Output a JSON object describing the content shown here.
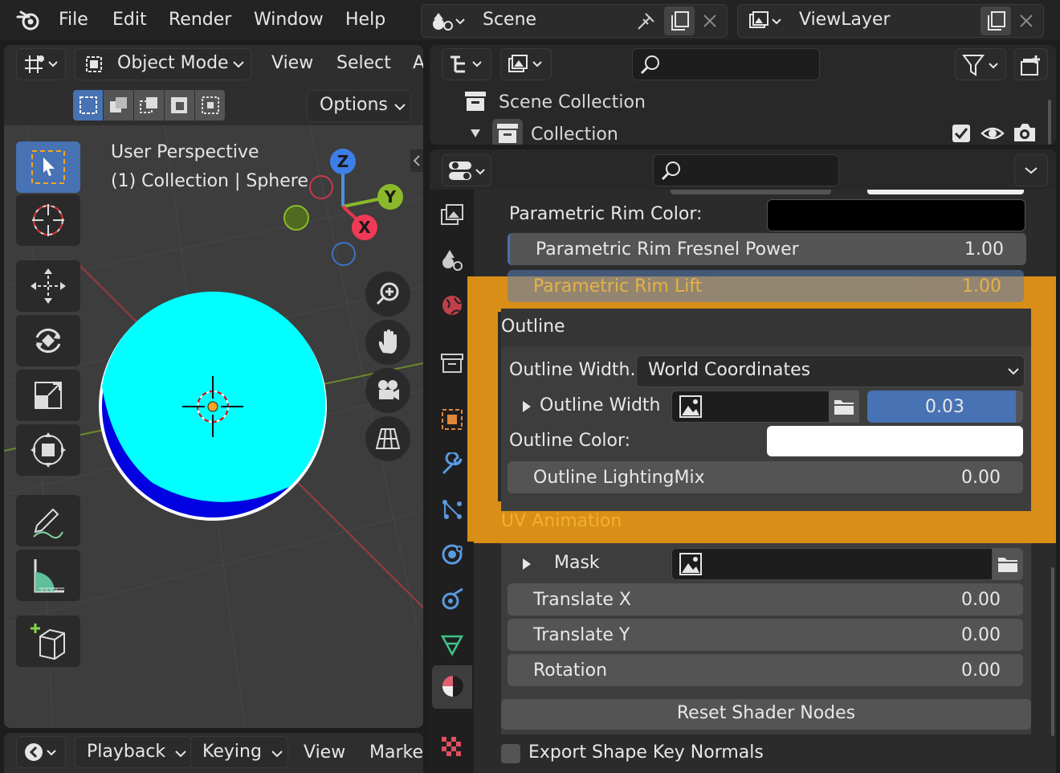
{
  "menubar": {
    "items": [
      "File",
      "Edit",
      "Render",
      "Window",
      "Help"
    ],
    "scene_label": "Scene",
    "viewlayer_label": "ViewLayer"
  },
  "viewport": {
    "mode_label": "Object Mode",
    "menu": [
      "View",
      "Select",
      "A"
    ],
    "options_label": "Options",
    "info_line1": "User Perspective",
    "info_line2": "(1) Collection | Sphere",
    "gizmo": {
      "z": "Z",
      "y": "Y",
      "x": "X"
    },
    "sphere_color": "#00ffff"
  },
  "timeline": {
    "items": [
      "Playback",
      "Keying",
      "View",
      "Marke"
    ]
  },
  "outliner": {
    "scene_collection": "Scene Collection",
    "collection": "Collection"
  },
  "properties": {
    "rim_color_label": "Parametric Rim Color:",
    "rim_fresnel": {
      "label": "Parametric Rim Fresnel Power",
      "value": "1.00"
    },
    "rim_lift": {
      "label": "Parametric Rim Lift",
      "value": "1.00"
    },
    "outline_header": "Outline",
    "outline_width_mode_label": "Outline Width...",
    "outline_width_mode_value": "World Coordinates",
    "outline_width": {
      "label": "Outline Width",
      "value": "0.03"
    },
    "outline_color_label": "Outline Color:",
    "outline_lightingmix": {
      "label": "Outline LightingMix",
      "value": "0.00"
    },
    "uv_animation_header": "UV Animation",
    "mask_label": "Mask",
    "translate_x": {
      "label": "Translate X",
      "value": "0.00"
    },
    "translate_y": {
      "label": "Translate Y",
      "value": "0.00"
    },
    "rotation": {
      "label": "Rotation",
      "value": "0.00"
    },
    "reset_button": "Reset Shader Nodes",
    "export_checkbox": "Export Shape Key Normals",
    "highlight_color": "#d98e17",
    "accent_color": "#4772b3"
  }
}
